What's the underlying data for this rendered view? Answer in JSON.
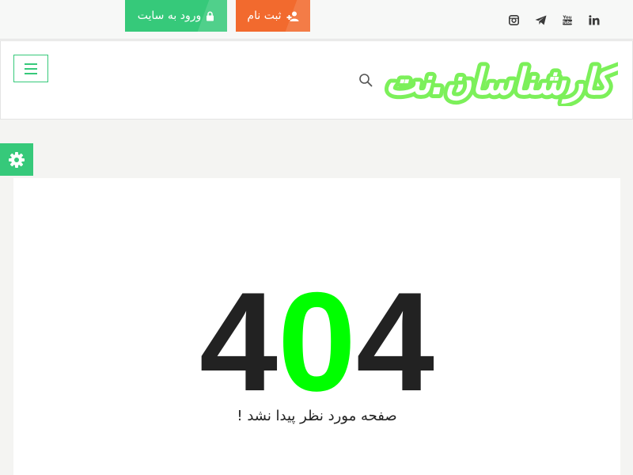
{
  "topbar": {
    "login_label": "ورود به سایت",
    "register_label": "ثبت نام",
    "social": [
      "in",
      "You Tube",
      "telegram",
      "instagram"
    ]
  },
  "header": {
    "logo_text": "کارشناسان.نت"
  },
  "error": {
    "code_first": "4",
    "code_middle": "0",
    "code_last": "4",
    "message": "صفحه مورد نظر پیدا نشد !"
  },
  "colors": {
    "green": "#36c97a",
    "orange": "#f26a2e",
    "neon": "#00ff00",
    "logo": "#7cf05a"
  }
}
